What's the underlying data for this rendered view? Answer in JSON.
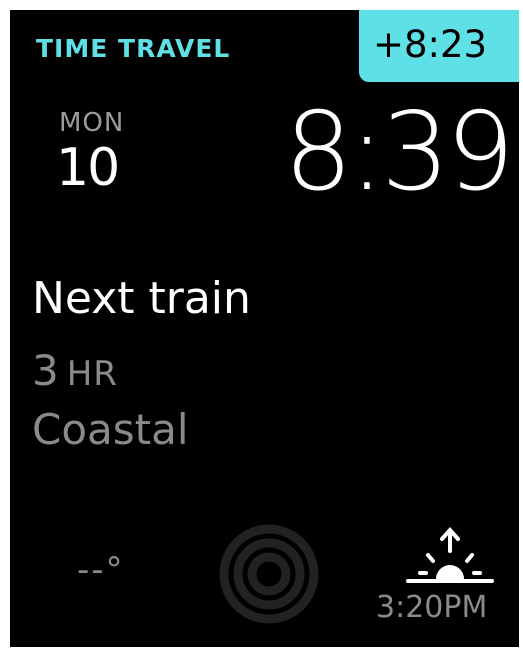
{
  "colors": {
    "accent": "#5fe0e6",
    "background": "#000000",
    "primary_text": "#ffffff",
    "secondary_text": "#8a8a8a"
  },
  "header": {
    "mode_label": "TIME TRAVEL",
    "offset": "+8:23"
  },
  "date": {
    "weekday": "MON",
    "day": "10"
  },
  "clock": {
    "time": "8:39"
  },
  "complication": {
    "title": "Next train",
    "value": "3",
    "unit": "HR",
    "destination": "Coastal"
  },
  "footer": {
    "temperature": "--°",
    "activity_icon": "activity-rings-icon",
    "sun_icon": "sunrise-icon",
    "sunrise_time": "3:20PM"
  }
}
